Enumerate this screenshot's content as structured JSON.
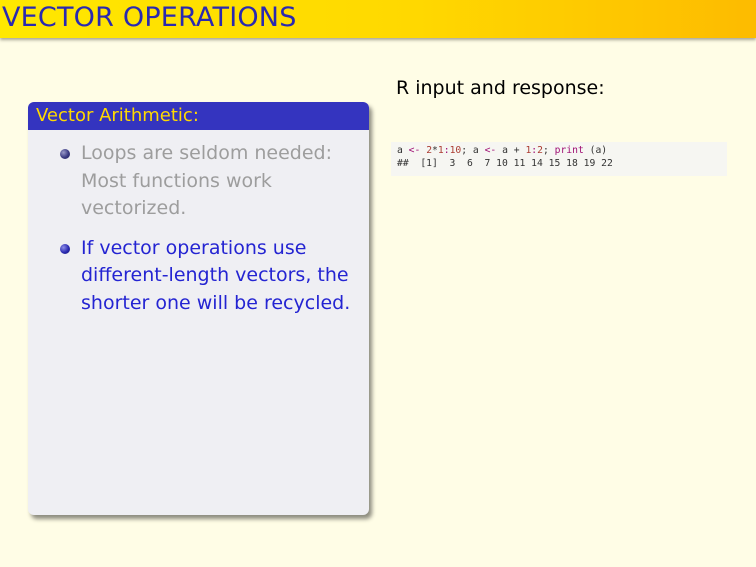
{
  "slide": {
    "title": "VECTOR OPERATIONS"
  },
  "block": {
    "heading": "Vector Arithmetic:",
    "items": [
      {
        "text": "Loops are seldom needed: Most functions work vectorized.",
        "state": "dimmed"
      },
      {
        "text": "If vector operations use different-length vectors, the shorter one will be recycled.",
        "state": "highlighted"
      }
    ]
  },
  "right": {
    "heading": "R input and response:"
  },
  "code": {
    "line1": {
      "t1": "a ",
      "t2": "<-",
      "t3": " ",
      "t4": "2",
      "t5": "*",
      "t6": "1",
      "t7": ":",
      "t8": "10",
      "t9": "; a ",
      "t10": "<-",
      "t11": " a ",
      "t12": "+",
      "t13": " ",
      "t14": "1",
      "t15": ":",
      "t16": "2",
      "t17": "; ",
      "t18": "print",
      "t19": " (a)"
    },
    "line2": "##  [1]  3  6  7 10 11 14 15 18 19 22"
  },
  "colors": {
    "title_bar": "#ffd800",
    "title_text": "#2a29b0",
    "block_header": "#3434bf",
    "block_header_text": "#ffd900",
    "highlight_text": "#2424d2",
    "dim_text": "#9d9d9d",
    "background": "#fffde6"
  }
}
